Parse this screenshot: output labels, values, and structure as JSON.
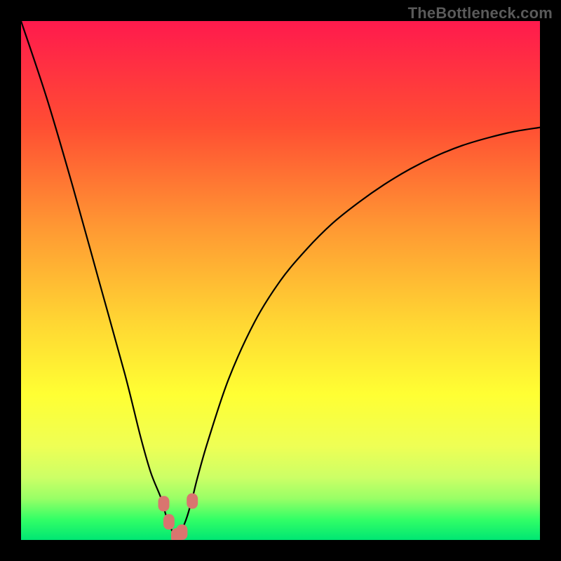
{
  "watermark": "TheBottleneck.com",
  "colors": {
    "bg": "#000000",
    "gradient_stops": [
      {
        "offset": 0.0,
        "color": "#ff1a4d"
      },
      {
        "offset": 0.2,
        "color": "#ff4d33"
      },
      {
        "offset": 0.4,
        "color": "#ff9933"
      },
      {
        "offset": 0.58,
        "color": "#ffd633"
      },
      {
        "offset": 0.72,
        "color": "#ffff33"
      },
      {
        "offset": 0.82,
        "color": "#eeff55"
      },
      {
        "offset": 0.88,
        "color": "#ccff66"
      },
      {
        "offset": 0.92,
        "color": "#99ff66"
      },
      {
        "offset": 0.96,
        "color": "#33ff66"
      },
      {
        "offset": 1.0,
        "color": "#00e673"
      }
    ],
    "curve": "#000000",
    "markers": "#d9756f"
  },
  "chart_data": {
    "type": "line",
    "title": "",
    "xlabel": "",
    "ylabel": "",
    "xlim": [
      0,
      100
    ],
    "ylim": [
      0,
      100
    ],
    "notch_x": 30,
    "series": [
      {
        "name": "bottleneck-curve",
        "x": [
          0,
          5,
          10,
          15,
          20,
          23,
          25,
          27,
          28,
          29,
          30,
          31,
          32,
          33,
          34,
          36,
          40,
          45,
          50,
          55,
          60,
          65,
          70,
          75,
          80,
          85,
          90,
          95,
          100
        ],
        "y": [
          100,
          85,
          68,
          50,
          32,
          20,
          13,
          8,
          4.5,
          2,
          0.5,
          2,
          4.5,
          8,
          12,
          19,
          31,
          42,
          50,
          56,
          61,
          65,
          68.5,
          71.5,
          74,
          76,
          77.5,
          78.7,
          79.5
        ]
      }
    ],
    "markers": [
      {
        "name": "left-marker",
        "x": 27.5,
        "y": 7.0
      },
      {
        "name": "left-marker-2",
        "x": 28.5,
        "y": 3.5
      },
      {
        "name": "bottom-marker",
        "x": 30.0,
        "y": 0.8
      },
      {
        "name": "bottom-marker-2",
        "x": 31.0,
        "y": 1.5
      },
      {
        "name": "right-marker",
        "x": 33.0,
        "y": 7.5
      }
    ]
  }
}
